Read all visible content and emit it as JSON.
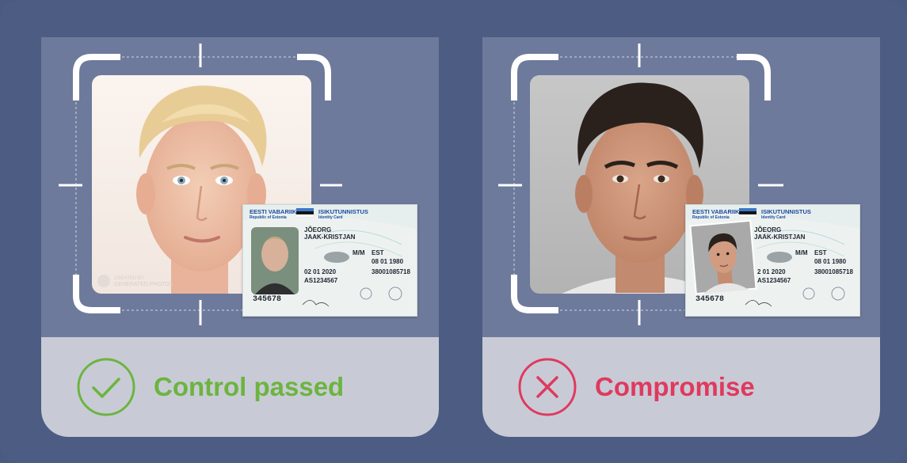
{
  "cards": [
    {
      "id": "passed",
      "status_label": "Control passed",
      "status_color": "#6cb43f",
      "icon": "check-circle-icon",
      "watermark": "GENERATED.PHOTOS",
      "id_card": {
        "country": "EESTI VABARIIK",
        "country_en": "Republic of Estonia",
        "doc_title": "ISIKUTUNNISTUS",
        "doc_title_en": "Identity Card",
        "surname": "JÕEORG",
        "given_names": "JAAK-KRISTJAN",
        "sex": "M/M",
        "nationality": "EST",
        "date_of_birth": "08 01 1980",
        "date_of_expiry": "02 01 2020",
        "personal_code": "38001085718",
        "document_number": "AS1234567",
        "card_number": "345678"
      }
    },
    {
      "id": "compromise",
      "status_label": "Compromise",
      "status_color": "#e0395e",
      "icon": "cross-circle-icon",
      "id_card": {
        "country": "EESTI VABARIIK",
        "country_en": "Republic of Estonia",
        "doc_title": "ISIKUTUNNISTUS",
        "doc_title_en": "Identity Card",
        "surname": "JÕEORG",
        "given_names": "JAAK-KRISTJAN",
        "sex": "M/M",
        "nationality": "EST",
        "date_of_birth": "08 01 1980",
        "date_of_expiry": "2 01 2020",
        "personal_code": "38001085718",
        "document_number": "AS1234567",
        "card_number": "345678"
      }
    }
  ],
  "colors": {
    "background": "#4c5c82",
    "card_top": "#6e7a9c",
    "card_bottom": "#c8cbd6",
    "frame": "#ffffff"
  }
}
